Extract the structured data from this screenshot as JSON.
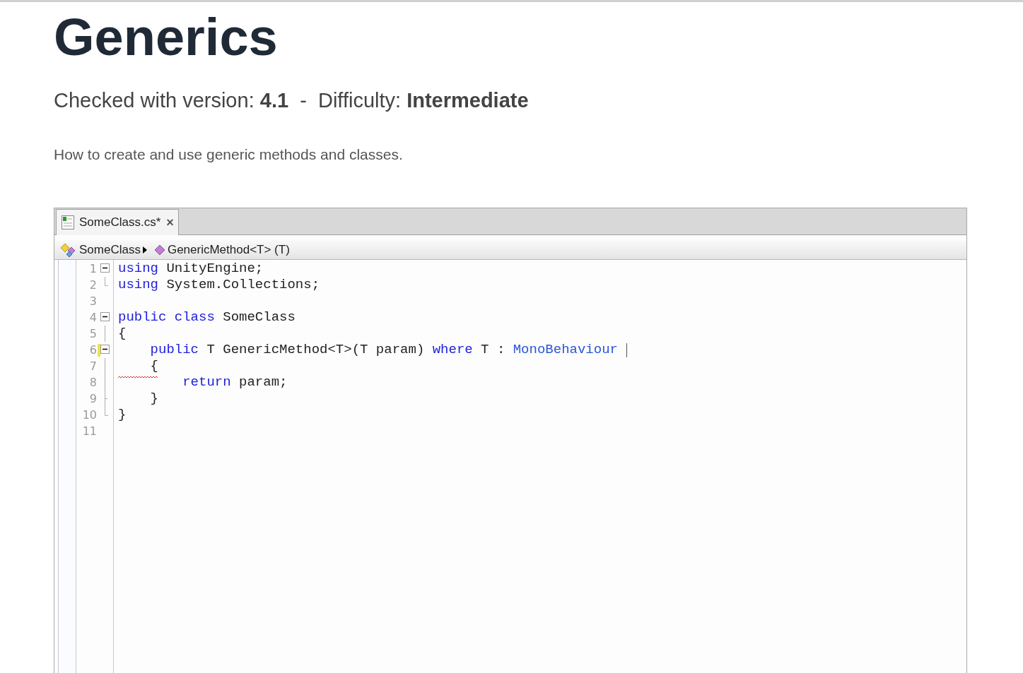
{
  "title": "Generics",
  "subtitle": "Checked with version: **4.1**  -  Difficulty: **Intermediate**",
  "description": "How to create and use generic methods and classes.",
  "editor": {
    "tab": {
      "label": "SomeClass.cs*",
      "close": "×",
      "selected": true
    },
    "breadcrumb": [
      {
        "kind": "class",
        "label": "SomeClass"
      },
      {
        "kind": "method",
        "label": "GenericMethod<T> (T)"
      }
    ],
    "lines": [
      {
        "number": "1",
        "kind": "start",
        "modified": false,
        "squiggle": false,
        "cursor": false,
        "tokens": [
          {
            "kind": "keyword",
            "text": "using"
          },
          {
            "kind": "plain",
            "text": " UnityEngine;"
          }
        ]
      },
      {
        "number": "2",
        "kind": "end",
        "modified": false,
        "squiggle": false,
        "cursor": false,
        "tokens": [
          {
            "kind": "keyword",
            "text": "using"
          },
          {
            "kind": "plain",
            "text": " System.Collections;"
          }
        ]
      },
      {
        "number": "3",
        "kind": "plain",
        "modified": false,
        "squiggle": false,
        "cursor": false
      },
      {
        "number": "4",
        "kind": "start",
        "modified": false,
        "squiggle": false,
        "cursor": false,
        "tokens": [
          {
            "kind": "keyword",
            "text": "public class"
          },
          {
            "kind": "plain",
            "text": " SomeClass"
          }
        ]
      },
      {
        "number": "5",
        "kind": "guide",
        "modified": false,
        "squiggle": false,
        "cursor": false,
        "tokens": [
          {
            "kind": "plain",
            "text": "{"
          }
        ]
      },
      {
        "number": "6",
        "kind": "start",
        "modified": true,
        "squiggle": false,
        "cursor": true,
        "tokens": [
          {
            "kind": "keyword",
            "text": "    public"
          },
          {
            "kind": "plain",
            "text": " T GenericMethod<T>(T param) "
          },
          {
            "kind": "keyword",
            "text": "where"
          },
          {
            "kind": "plain",
            "text": " T : "
          },
          {
            "kind": "type",
            "text": "MonoBehaviour"
          }
        ]
      },
      {
        "number": "7",
        "kind": "guide",
        "modified": false,
        "squiggle": true,
        "cursor": false,
        "tokens": [
          {
            "kind": "plain",
            "text": "    {"
          }
        ]
      },
      {
        "number": "8",
        "kind": "guide",
        "modified": false,
        "squiggle": false,
        "cursor": false,
        "tokens": [
          {
            "kind": "keyword",
            "text": "        return"
          },
          {
            "kind": "plain",
            "text": " param;"
          }
        ]
      },
      {
        "number": "9",
        "kind": "tick",
        "modified": false,
        "squiggle": false,
        "cursor": false,
        "tokens": [
          {
            "kind": "plain",
            "text": "    }"
          }
        ]
      },
      {
        "number": "10",
        "kind": "end",
        "modified": false,
        "squiggle": false,
        "cursor": false,
        "tokens": [
          {
            "kind": "plain",
            "text": "}"
          }
        ]
      },
      {
        "number": "11",
        "kind": "plain",
        "modified": false,
        "squiggle": false,
        "cursor": false
      }
    ]
  }
}
